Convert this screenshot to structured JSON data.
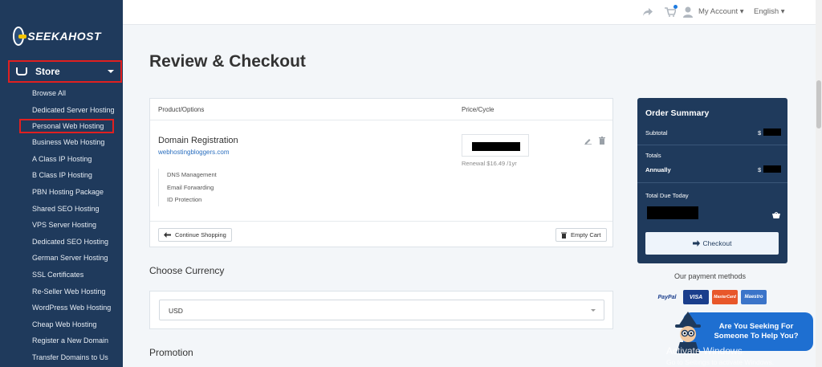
{
  "brand": {
    "logo_text": "SEEKAHOST"
  },
  "sidebar": {
    "store_label": "Store",
    "items": [
      "Browse All",
      "Dedicated Server Hosting",
      "Personal Web Hosting",
      "Business Web Hosting",
      "A Class IP Hosting",
      "B Class IP Hosting",
      "PBN Hosting Package",
      "Shared SEO Hosting",
      "VPS Server Hosting",
      "Dedicated SEO Hosting",
      "German Server Hosting",
      "SSL Certificates",
      "Re-Seller Web Hosting",
      "WordPress Web Hosting",
      "Cheap Web Hosting",
      "Register a New Domain",
      "Transfer Domains to Us"
    ],
    "active_item": "Personal Web Hosting"
  },
  "topbar": {
    "account_label": "My Account",
    "language_label": "English"
  },
  "page": {
    "title": "Review & Checkout"
  },
  "cart": {
    "col_product": "Product/Options",
    "col_price": "Price/Cycle",
    "product_name": "Domain Registration",
    "product_domain": "webhostingbloggers.com",
    "renewal": "Renewal $16.49 /1yr",
    "addons": [
      "DNS Management",
      "Email Forwarding",
      "ID Protection"
    ],
    "continue_label": "Continue Shopping",
    "empty_label": "Empty Cart"
  },
  "currency": {
    "section_title": "Choose Currency",
    "selected": "USD"
  },
  "promotion": {
    "section_title": "Promotion"
  },
  "summary": {
    "title": "Order Summary",
    "subtotal_label": "Subtotal",
    "subtotal_value": "$",
    "totals_label": "Totals",
    "annually_label": "Annually",
    "annually_value": "$",
    "due_label": "Total Due Today",
    "checkout_label": "Checkout"
  },
  "payment": {
    "title": "Our payment methods",
    "methods": [
      "PayPal",
      "VISA",
      "MasterCard",
      "Maestro"
    ]
  },
  "chat": {
    "line1": "Are You Seeking For",
    "line2": "Someone To Help You?"
  },
  "watermark": {
    "line1": "Activate Windows",
    "line2": "Go to Settings to activate Windows."
  },
  "colors": {
    "sidebar": "#1f3a5c",
    "accent": "#1e6fd1",
    "highlight": "#e02020"
  }
}
